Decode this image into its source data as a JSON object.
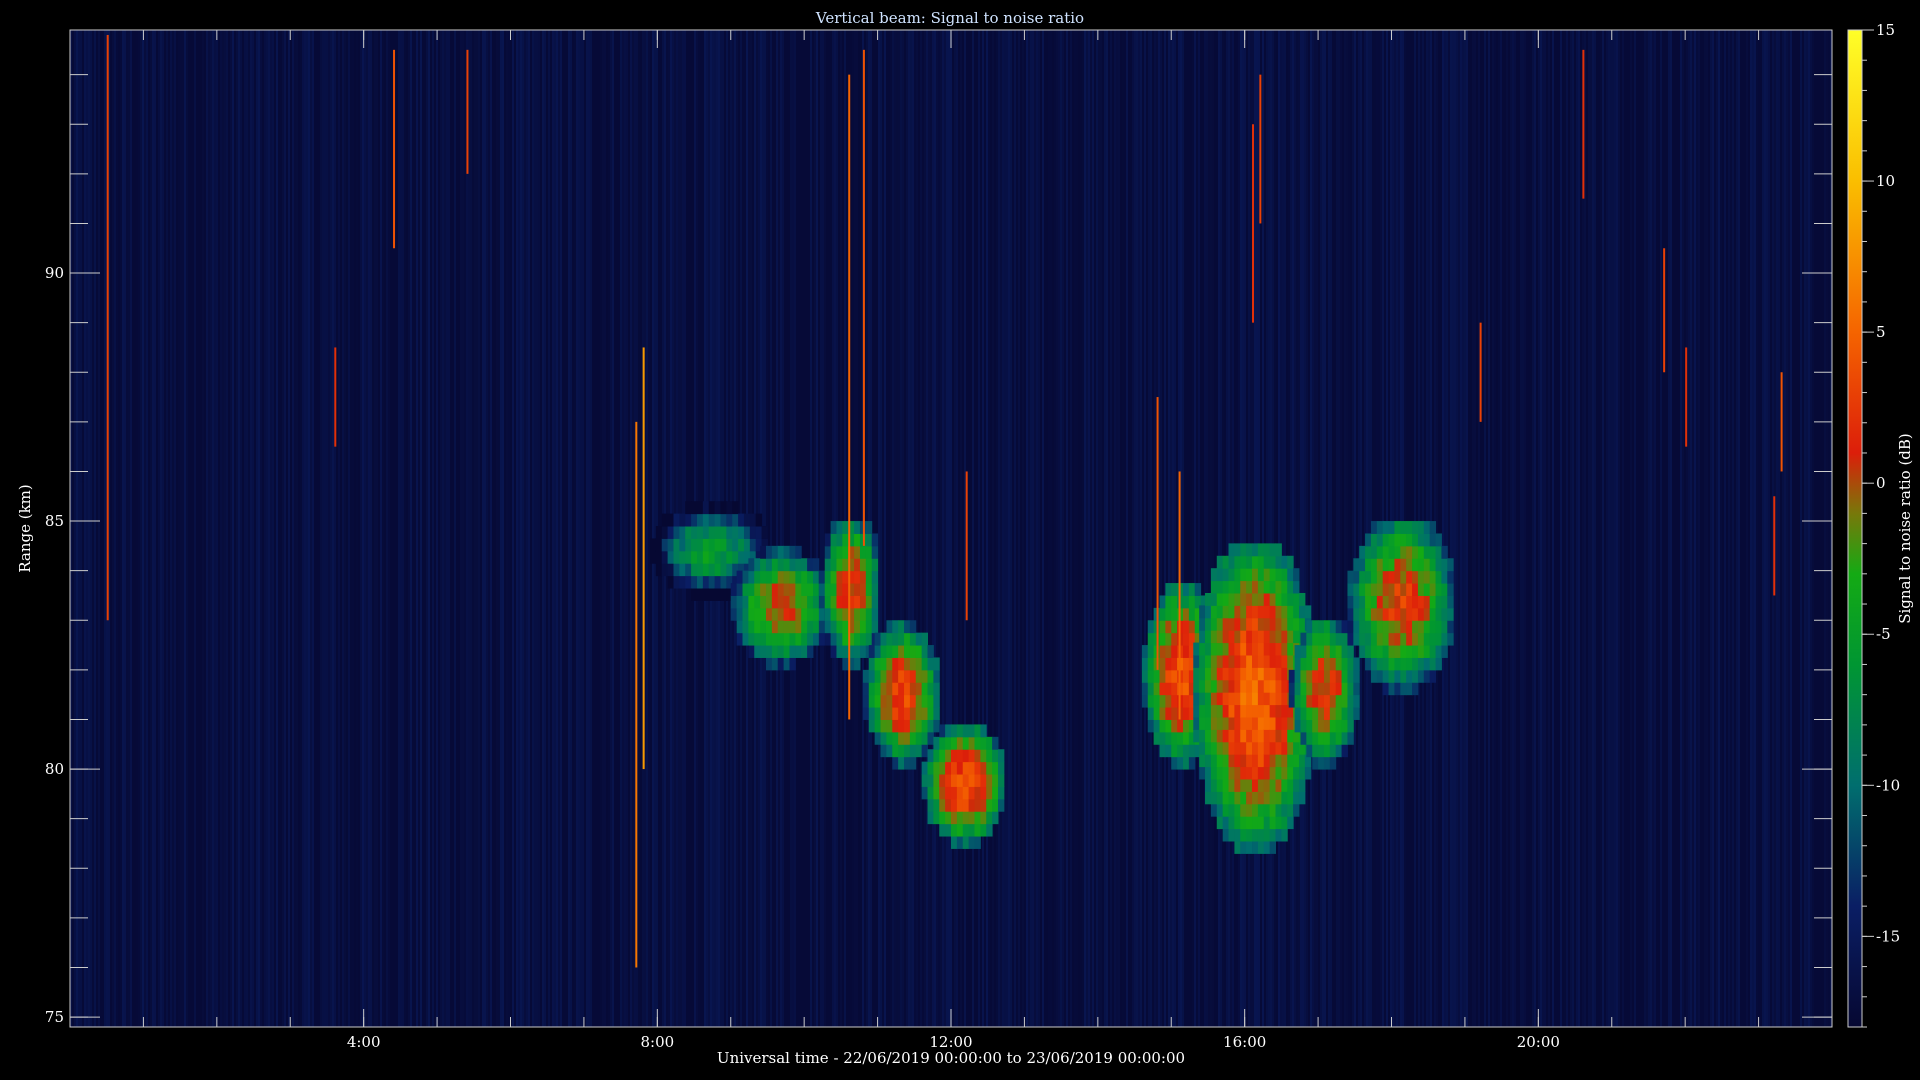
{
  "chart_data": {
    "type": "heatmap",
    "title": "Vertical beam: Signal to noise ratio",
    "xlabel": "Universal time - 22/06/2019 00:00:00 to 23/06/2019 00:00:00",
    "ylabel": "Range (km)",
    "colorbar_label": "Signal to noise ratio (dB)",
    "x_unit": "hours UT",
    "xlim": [
      0,
      24
    ],
    "ylim": [
      74.8,
      94.9
    ],
    "zlim": [
      -18,
      15
    ],
    "x_ticks": [
      {
        "value": 4,
        "label": "4:00"
      },
      {
        "value": 8,
        "label": "8:00"
      },
      {
        "value": 12,
        "label": "12:00"
      },
      {
        "value": 16,
        "label": "16:00"
      },
      {
        "value": 20,
        "label": "20:00"
      }
    ],
    "x_minor_step": 1,
    "y_ticks": [
      {
        "value": 75,
        "label": "75"
      },
      {
        "value": 80,
        "label": "80"
      },
      {
        "value": 85,
        "label": "85"
      },
      {
        "value": 90,
        "label": "90"
      }
    ],
    "y_minor_step": 1,
    "colorbar_ticks": [
      {
        "value": 15,
        "label": "15"
      },
      {
        "value": 10,
        "label": "10"
      },
      {
        "value": 5,
        "label": "5"
      },
      {
        "value": 0,
        "label": "0"
      },
      {
        "value": -5,
        "label": "-5"
      },
      {
        "value": -10,
        "label": "-10"
      },
      {
        "value": -15,
        "label": "-15"
      }
    ],
    "colorbar_minor_step": 1,
    "background_level_db": -17,
    "regions": [
      {
        "t": [
          7.9,
          9.5
        ],
        "r": [
          83.4,
          85.2
        ],
        "peak_db": -5
      },
      {
        "t": [
          9.0,
          10.3
        ],
        "r": [
          82.0,
          84.3
        ],
        "peak_db": 1
      },
      {
        "t": [
          10.2,
          11.0
        ],
        "r": [
          82.0,
          85.0
        ],
        "peak_db": 2
      },
      {
        "t": [
          10.8,
          11.8
        ],
        "r": [
          80.0,
          82.8
        ],
        "peak_db": 3
      },
      {
        "t": [
          11.6,
          12.7
        ],
        "r": [
          78.4,
          80.8
        ],
        "peak_db": 4
      },
      {
        "t": [
          14.6,
          15.6
        ],
        "r": [
          80.0,
          83.6
        ],
        "peak_db": 4
      },
      {
        "t": [
          15.3,
          16.9
        ],
        "r": [
          78.3,
          84.5
        ],
        "peak_db": 5
      },
      {
        "t": [
          16.6,
          17.5
        ],
        "r": [
          80.0,
          83.0
        ],
        "peak_db": 2
      },
      {
        "t": [
          17.4,
          18.8
        ],
        "r": [
          81.5,
          85.0
        ],
        "peak_db": 2
      }
    ],
    "spikes": [
      {
        "t": 0.5,
        "r": [
          83.0,
          94.8
        ],
        "db": 3
      },
      {
        "t": 3.6,
        "r": [
          86.5,
          88.5
        ],
        "db": 2
      },
      {
        "t": 4.4,
        "r": [
          90.5,
          94.5
        ],
        "db": 4
      },
      {
        "t": 5.4,
        "r": [
          92.0,
          94.5
        ],
        "db": 3
      },
      {
        "t": 7.7,
        "r": [
          76.0,
          87.0
        ],
        "db": 6
      },
      {
        "t": 7.8,
        "r": [
          80.0,
          88.5
        ],
        "db": 8
      },
      {
        "t": 10.8,
        "r": [
          84.5,
          94.5
        ],
        "db": 4
      },
      {
        "t": 10.6,
        "r": [
          81.0,
          94.0
        ],
        "db": 5
      },
      {
        "t": 12.2,
        "r": [
          83.0,
          86.0
        ],
        "db": 3
      },
      {
        "t": 14.8,
        "r": [
          82.0,
          87.5
        ],
        "db": 4
      },
      {
        "t": 15.1,
        "r": [
          81.0,
          86.0
        ],
        "db": 5
      },
      {
        "t": 16.2,
        "r": [
          91.0,
          94.0
        ],
        "db": 3
      },
      {
        "t": 16.1,
        "r": [
          89.0,
          93.0
        ],
        "db": 2
      },
      {
        "t": 19.2,
        "r": [
          87.0,
          89.0
        ],
        "db": 3
      },
      {
        "t": 20.6,
        "r": [
          91.5,
          94.5
        ],
        "db": 2
      },
      {
        "t": 21.7,
        "r": [
          88.0,
          90.5
        ],
        "db": 3
      },
      {
        "t": 22.0,
        "r": [
          86.5,
          88.5
        ],
        "db": 2
      },
      {
        "t": 23.3,
        "r": [
          86.0,
          88.0
        ],
        "db": 4
      },
      {
        "t": 23.2,
        "r": [
          83.5,
          85.5
        ],
        "db": 2
      }
    ],
    "grid": false,
    "legend": "colorbar-right"
  }
}
